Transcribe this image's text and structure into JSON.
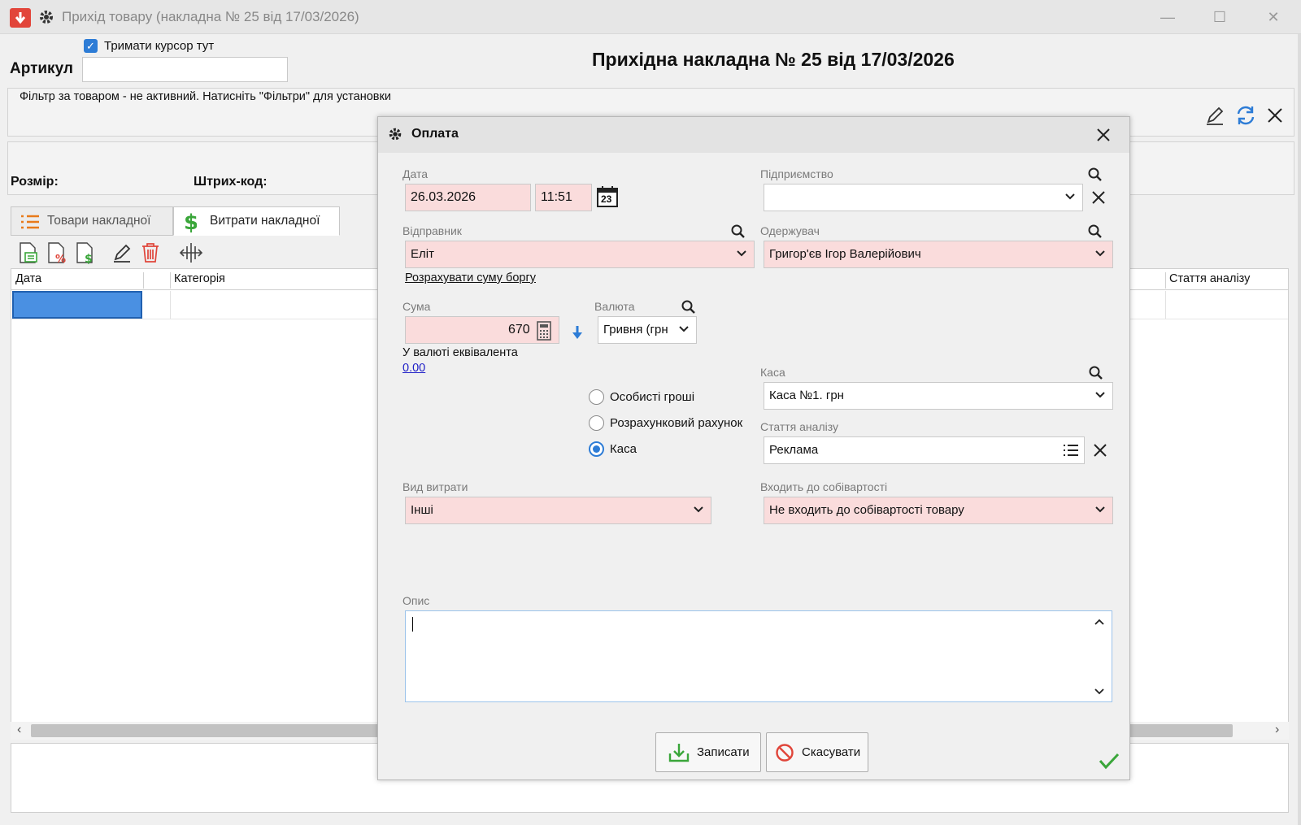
{
  "window": {
    "title": "Прихід товару (накладна № 25 від 17/03/2026)"
  },
  "header": {
    "keep_cursor_label": "Тримати курсор тут",
    "article_label": "Артикул",
    "doc_title": "Прихідна накладна № 25 від 17/03/2026",
    "filter_text": "Фільтр за товаром - не активний. Натисніть \"Фільтри\" для установки",
    "size_label": "Розмір:",
    "barcode_label": "Штрих-код:"
  },
  "tabs": [
    {
      "label": "Товари накладної"
    },
    {
      "label": "Витрати накладної"
    }
  ],
  "grid": {
    "columns": [
      "Дата",
      "Категорія",
      "Стаття аналізу"
    ]
  },
  "dialog": {
    "title": "Оплата",
    "date_label": "Дата",
    "date_value": "26.03.2026",
    "time_value": "11:51",
    "calendar_day": "23",
    "enterprise_label": "Підприємство",
    "enterprise_value": "",
    "sender_label": "Відправник",
    "sender_value": "Еліт",
    "recipient_label": "Одержувач",
    "recipient_value": "Григор'єв Ігор Валерійович",
    "calc_debt_link": "Розрахувати суму боргу",
    "sum_label": "Сума",
    "sum_value": "670",
    "currency_label": "Валюта",
    "currency_value": "Гривня (грн",
    "equiv_label": "У валюті еквівалента",
    "equiv_value": "0.00",
    "radio_personal": "Особисті гроші",
    "radio_account": "Розрахунковий рахунок",
    "radio_cash": "Каса",
    "selected_radio": "cash",
    "cashbox_label": "Каса",
    "cashbox_value": "Каса №1. грн",
    "analysis_label": "Стаття аналізу",
    "analysis_value": "Реклама",
    "expense_type_label": "Вид витрати",
    "expense_type_value": "Інші",
    "cost_label": "Входить до собівартості",
    "cost_value": "Не входить до собівартості товару",
    "description_label": "Опис",
    "description_value": "",
    "save_label": "Записати",
    "cancel_label": "Скасувати"
  },
  "colors": {
    "accent": "#2d7cd6",
    "required_bg": "#fadcdc",
    "selected_cell": "#4a90e2",
    "green": "#3aa63a",
    "red": "#e0453a"
  }
}
